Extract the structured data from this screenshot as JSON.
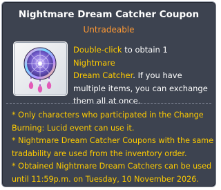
{
  "tooltip": {
    "title": "Nightmare Dream Catcher Coupon",
    "tradeability": "Untradeable",
    "item_icon": "dream-catcher-icon",
    "description": {
      "action": "Double-click",
      "text_1": " to obtain 1 ",
      "item_name": "Nightmare\nDream Catcher",
      "text_2": ". If you have multiple items, you can exchange them all at once."
    },
    "notes": [
      "* Only characters who participated in the Change Burning: Lucid event can use it.",
      "* Nightmare Dream Catcher Coupons with the same tradability are used from the inventory order.",
      "* Obtained Nightmare Dream Catchers can be used until 11:59p.m. on Tuesday, 10 November 2026."
    ],
    "colors": {
      "background": "#3d4350",
      "title": "#ffffff",
      "tradeability": "#ff9933",
      "highlight": "#ffcc00"
    }
  }
}
